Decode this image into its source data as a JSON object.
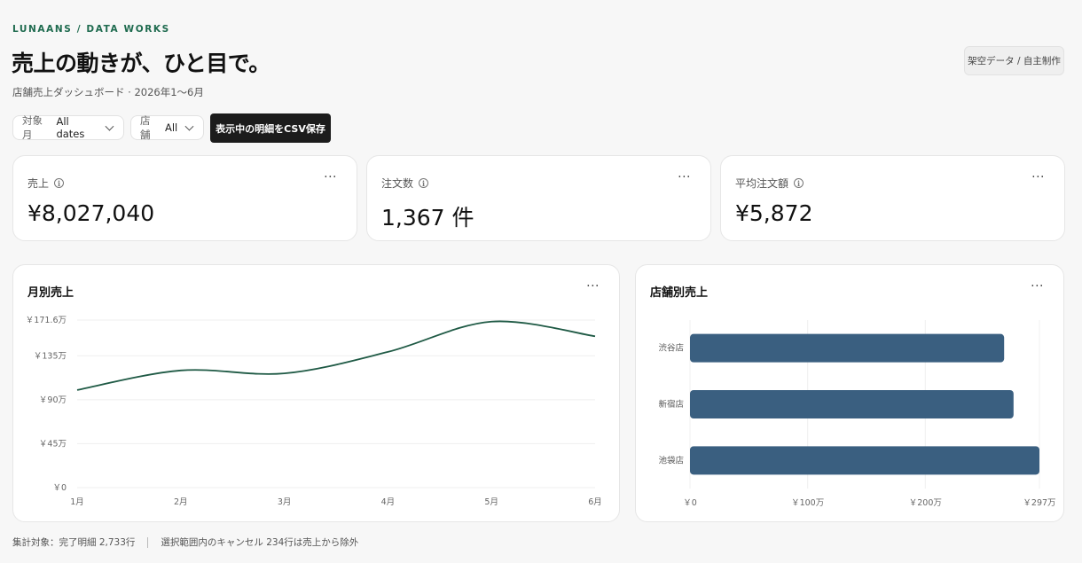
{
  "header": {
    "brand": "LUNAANS / DATA WORKS",
    "headline": "売上の動きが、ひと目で。",
    "subtitle": "店舗売上ダッシュボード · 2026年1〜6月",
    "badge": "架空データ / 自主制作"
  },
  "filters": [
    {
      "label": "対象月",
      "value": "All dates"
    },
    {
      "label": "店舗",
      "value": "All"
    }
  ],
  "export_button": "表示中の明細をCSV保存",
  "kpis": [
    {
      "label": "売上",
      "value": "¥8,027,040"
    },
    {
      "label": "注文数",
      "value": "1,367 件"
    },
    {
      "label": "平均注文額",
      "value": "¥5,872"
    }
  ],
  "more_label": "···",
  "line_card": {
    "title": "月別売上"
  },
  "bar_card": {
    "title": "店舗別売上"
  },
  "footer": {
    "left": "集計対象：完了明細 2,733行",
    "right": "選択範囲内のキャンセル 234行は売上から除外"
  },
  "colors": {
    "line": "#1f5a45",
    "bar": "#3a5f80",
    "brand": "#1f6b4f"
  },
  "chart_data": [
    {
      "type": "line",
      "title": "月別売上",
      "x": [
        "1月",
        "2月",
        "3月",
        "4月",
        "5月",
        "6月"
      ],
      "series": [
        {
          "values": [
            1.0,
            1.2,
            1.17,
            1.39,
            1.7,
            1.55
          ]
        }
      ],
      "yticks": [
        0,
        0.45,
        0.9,
        1.35,
        1.716
      ],
      "ytick_labels": [
        "￥0",
        "￥45万",
        "￥90万",
        "￥135万",
        "￥171.6万"
      ],
      "ylim": [
        0,
        1.716
      ],
      "unit": "百万円",
      "grid": true
    },
    {
      "type": "bar",
      "orientation": "horizontal",
      "title": "店舗別売上",
      "categories": [
        "渋谷店",
        "新宿店",
        "池袋店"
      ],
      "values": [
        2.67,
        2.75,
        2.97
      ],
      "xticks": [
        0,
        1,
        2,
        2.97
      ],
      "xtick_labels": [
        "￥0",
        "￥100万",
        "￥200万",
        "￥297万"
      ],
      "xlim": [
        0,
        2.97
      ],
      "unit": "百万円",
      "grid": true
    }
  ]
}
